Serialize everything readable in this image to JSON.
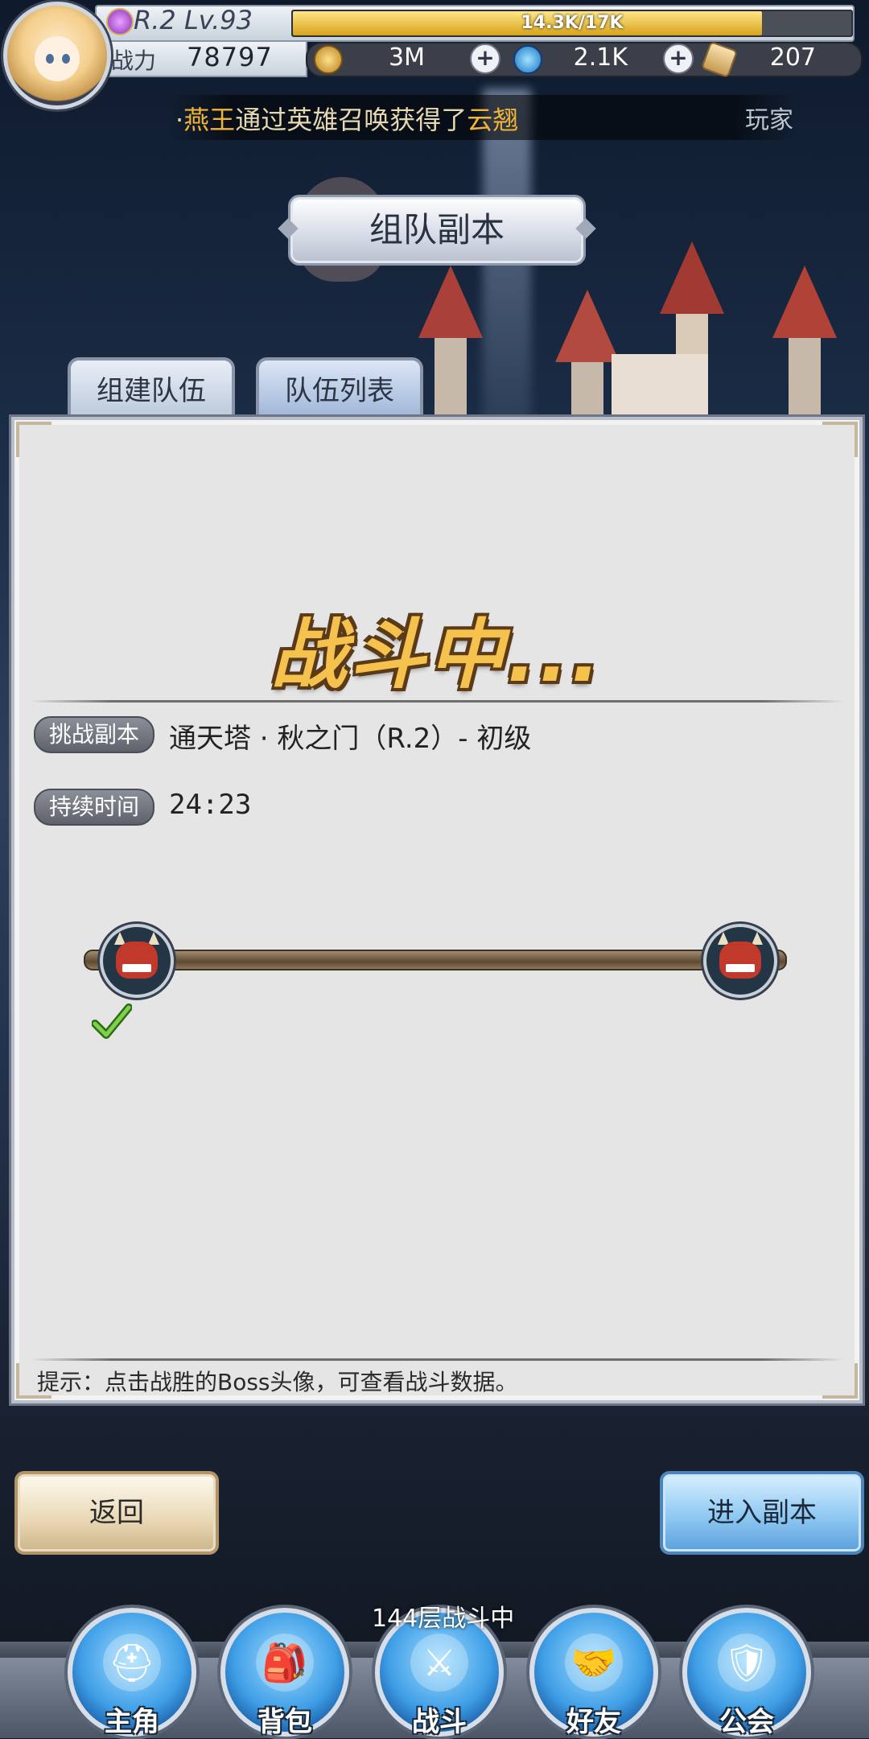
{
  "hud": {
    "rank_level": "R.2 Lv.93",
    "exp_text": "14.3K/17K",
    "exp_progress": 0.84,
    "power_label": "战力",
    "power_value": "78797",
    "gold": "3M",
    "gems": "2.1K",
    "tickets": "207"
  },
  "marquee": {
    "prefix": "·",
    "player": "燕王",
    "middle": "通过英雄召唤获得了",
    "item": "云翘",
    "next": "玩家"
  },
  "title": "组队副本",
  "tabs": [
    "组建队伍",
    "队伍列表"
  ],
  "panel": {
    "status": "战斗中...",
    "dungeon_label": "挑战副本",
    "dungeon_value": "通天塔 · 秋之门（R.2）- 初级",
    "duration_label": "持续时间",
    "duration_value": "24:23",
    "hint": "提示：点击战胜的Boss头像，可查看战斗数据。",
    "bosses_defeated": 1,
    "bosses_total": 2
  },
  "buttons": {
    "back": "返回",
    "enter": "进入副本"
  },
  "nav": {
    "items": [
      "主角",
      "背包",
      "战斗",
      "好友",
      "公会"
    ],
    "battle_badge": "144层战斗中"
  },
  "colors": {
    "accent_gold": "#f6c24e",
    "exp_fill": "#d7a318",
    "nav_blue": "#3f9ee6"
  }
}
